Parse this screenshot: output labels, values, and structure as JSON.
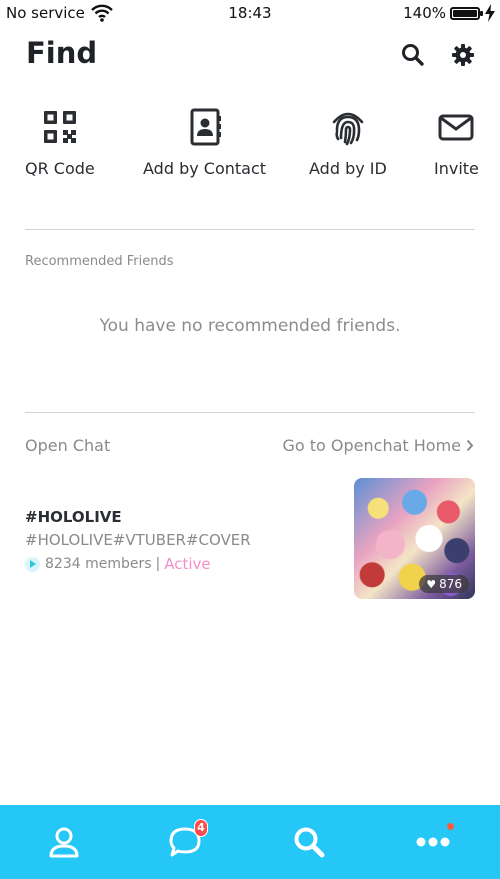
{
  "status": {
    "carrier": "No service",
    "time": "18:43",
    "battery": "140%"
  },
  "header": {
    "title": "Find"
  },
  "actions": [
    {
      "label": "QR Code",
      "icon": "qr-code-icon"
    },
    {
      "label": "Add by Contact",
      "icon": "contact-book-icon"
    },
    {
      "label": "Add by ID",
      "icon": "fingerprint-icon"
    },
    {
      "label": "Invite",
      "icon": "envelope-icon"
    }
  ],
  "recommended": {
    "label": "Recommended Friends",
    "empty_message": "You have no recommended friends."
  },
  "openchat": {
    "label": "Open Chat",
    "link": "Go to Openchat Home",
    "item": {
      "name": "#HOLOLIVE",
      "tags": "#HOLOLIVE#VTUBER#COVER",
      "members": "8234 members",
      "separator": "|",
      "status": "Active",
      "likes": "876"
    }
  },
  "nav": {
    "chats_badge": "4"
  },
  "colors": {
    "nav_bg": "#25c7f7",
    "active": "#f48fc7",
    "badge": "#ff4d4d"
  }
}
